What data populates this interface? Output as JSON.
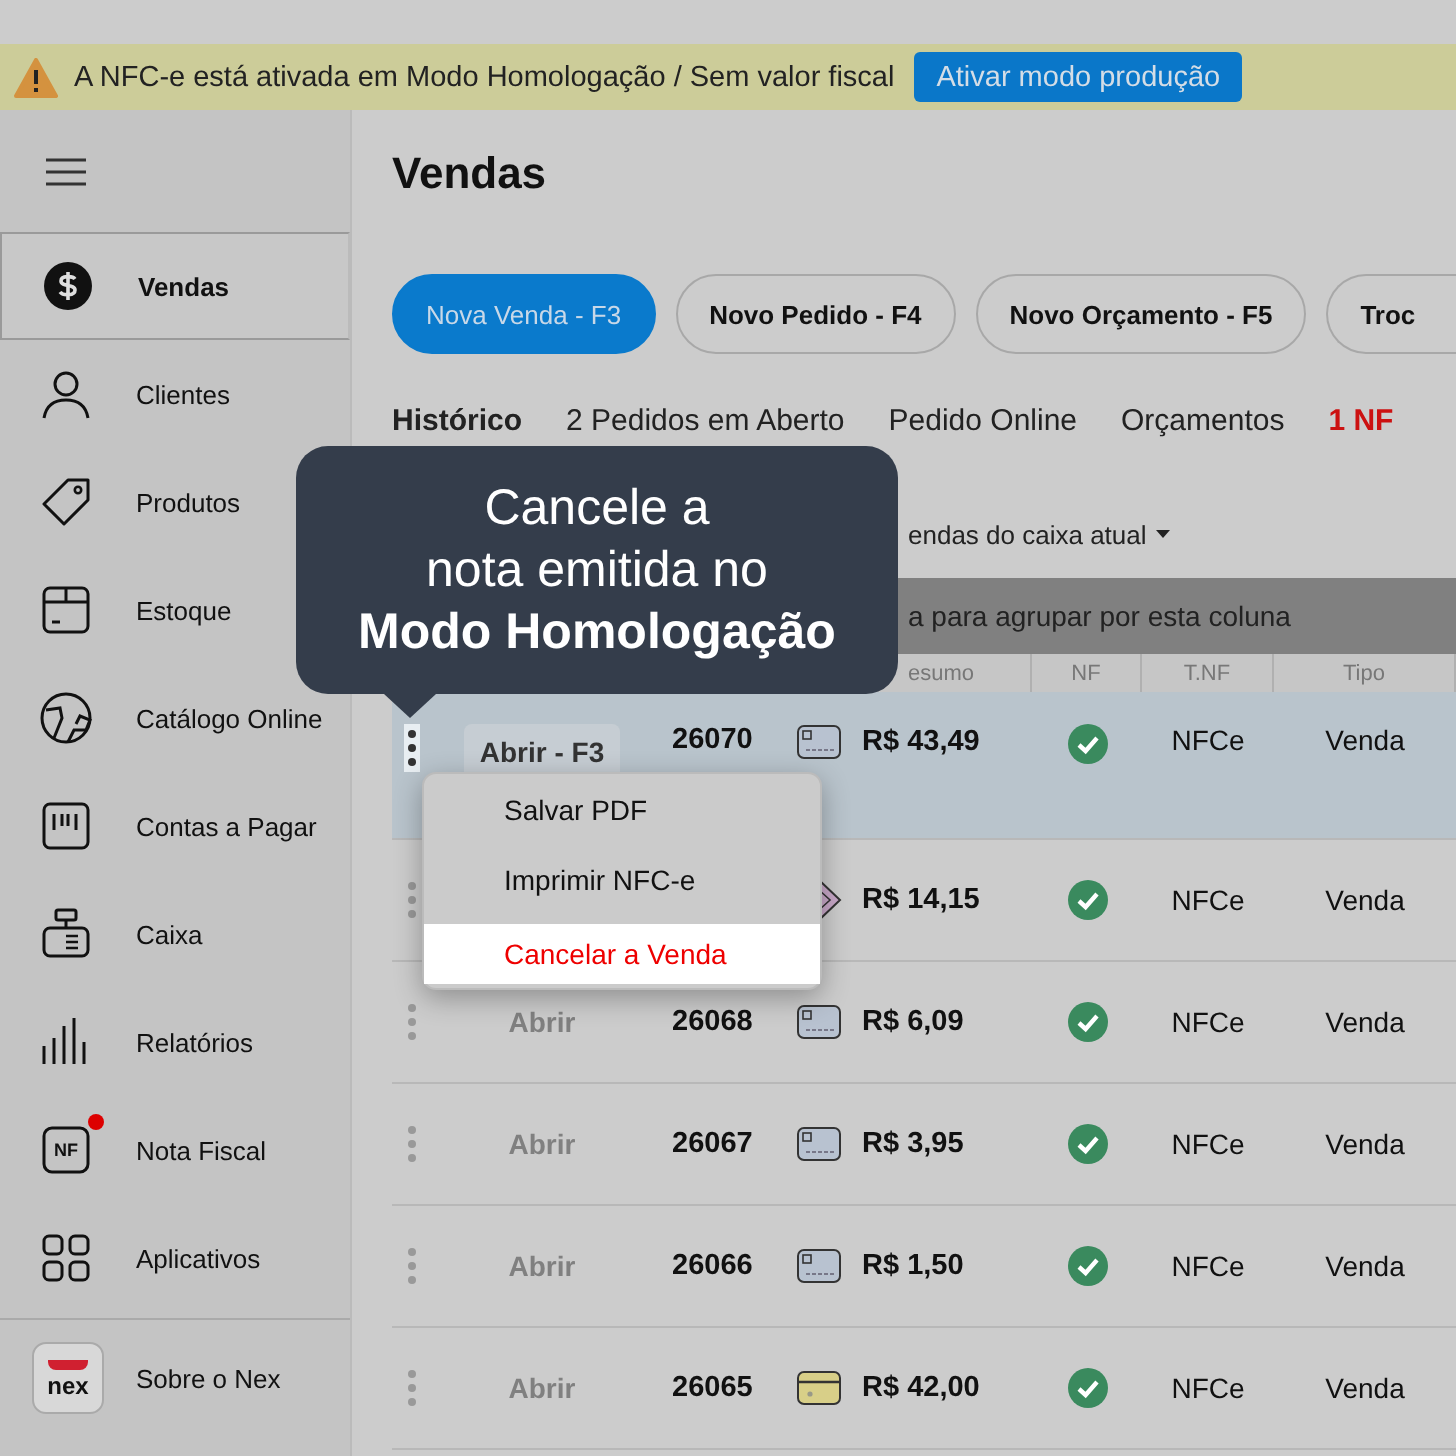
{
  "banner": {
    "message": "A NFC-e está ativada em Modo Homologação / Sem valor fiscal",
    "button": "Ativar modo produção"
  },
  "sidebar": {
    "items": [
      {
        "label": "Vendas",
        "selected": true
      },
      {
        "label": "Clientes",
        "selected": false
      },
      {
        "label": "Produtos",
        "selected": false
      },
      {
        "label": "Estoque",
        "selected": false
      },
      {
        "label": "Catálogo Online",
        "selected": false
      },
      {
        "label": "Contas a Pagar",
        "selected": false
      },
      {
        "label": "Caixa",
        "selected": false
      },
      {
        "label": "Relatórios",
        "selected": false
      },
      {
        "label": "Nota Fiscal",
        "icon_text": "NF",
        "badge": true,
        "selected": false
      },
      {
        "label": "Aplicativos",
        "selected": false
      }
    ],
    "footer": {
      "label": "Sobre o Nex",
      "logo_text": "nex"
    }
  },
  "page": {
    "title": "Vendas",
    "actions": [
      {
        "label": "Nova Venda - F3",
        "selected": true
      },
      {
        "label": "Novo Pedido - F4",
        "selected": false
      },
      {
        "label": "Novo Orçamento - F5",
        "selected": false
      },
      {
        "label": "Troc",
        "selected": false
      }
    ],
    "tabs": [
      {
        "label": "Histórico",
        "selected": true,
        "kind": "normal"
      },
      {
        "label": "2 Pedidos em Aberto",
        "selected": false,
        "kind": "normal"
      },
      {
        "label": "Pedido Online",
        "selected": false,
        "kind": "normal"
      },
      {
        "label": "Orçamentos",
        "selected": false,
        "kind": "normal"
      },
      {
        "label": "1 NF",
        "selected": false,
        "kind": "alert"
      }
    ],
    "filter": "endas do caixa atual",
    "group_hint": "a para agrupar por esta coluna",
    "table": {
      "header": {
        "column_4": "esumo",
        "column_5": "NF",
        "column_6": "T.NF",
        "column_7": "Tipo"
      },
      "rows": [
        {
          "open": "Abrir - F3",
          "number": "26070",
          "kind": "card",
          "amount": "R$ 43,49",
          "nf_issued": true,
          "nf_type": "NFCe",
          "type": "Venda",
          "selected": true
        },
        {
          "kind": "pix",
          "amount": "R$ 14,15",
          "nf_issued": true,
          "nf_type": "NFCe",
          "type": "Venda",
          "selected": false
        },
        {
          "open": "Abrir",
          "number": "26068",
          "kind": "card",
          "amount": "R$ 6,09",
          "nf_issued": true,
          "nf_type": "NFCe",
          "type": "Venda",
          "selected": false
        },
        {
          "open": "Abrir",
          "number": "26067",
          "kind": "card",
          "amount": "R$ 3,95",
          "nf_issued": true,
          "nf_type": "NFCe",
          "type": "Venda",
          "selected": false
        },
        {
          "open": "Abrir",
          "number": "26066",
          "kind": "card",
          "amount": "R$ 1,50",
          "nf_issued": true,
          "nf_type": "NFCe",
          "type": "Venda",
          "selected": false
        },
        {
          "open": "Abrir",
          "number": "26065",
          "kind": "cash",
          "amount": "R$ 42,00",
          "nf_issued": true,
          "nf_type": "NFCe",
          "type": "Venda",
          "selected": false
        }
      ]
    }
  },
  "menu": {
    "items": [
      {
        "label": "Salvar PDF",
        "kind": "normal",
        "selected": false
      },
      {
        "label": "Imprimir NFC-e",
        "kind": "normal",
        "selected": false
      },
      {
        "label": "Cancelar a Venda",
        "kind": "danger",
        "selected": true
      }
    ]
  },
  "tooltip": {
    "lines": [
      {
        "text": "Cancele a",
        "bold": false
      },
      {
        "text": "nota emitida no",
        "bold": false
      },
      {
        "text": "Modo Homologação",
        "bold": true
      }
    ]
  }
}
